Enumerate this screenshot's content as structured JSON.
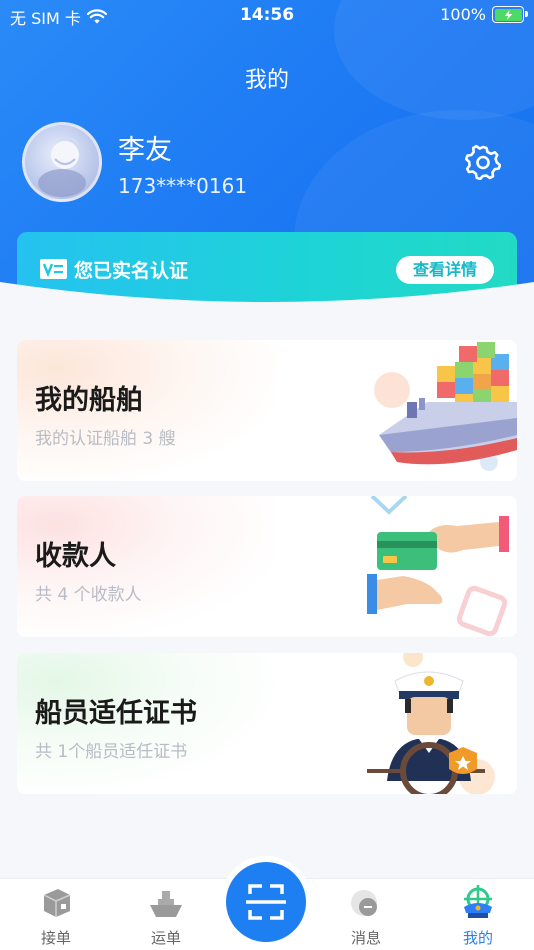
{
  "status_bar": {
    "carrier": "无 SIM 卡",
    "time": "14:56",
    "battery": "100%"
  },
  "header": {
    "title": "我的",
    "user_name": "李友",
    "phone": "173****0161"
  },
  "verify": {
    "text": "您已实名认证",
    "button": "查看详情"
  },
  "cards": [
    {
      "title": "我的船舶",
      "subtitle": "我的认证船舶 3 艘",
      "icon": "cargo-ship-icon"
    },
    {
      "title": "收款人",
      "subtitle": "共 4 个收款人",
      "icon": "payment-card-icon"
    },
    {
      "title": "船员适任证书",
      "subtitle": "共 1个船员适任证书",
      "icon": "ship-captain-icon"
    }
  ],
  "tabbar": {
    "items": [
      {
        "label": "接单",
        "icon": "box-icon"
      },
      {
        "label": "运单",
        "icon": "ship-icon"
      },
      {
        "label": "",
        "icon": "scan-icon"
      },
      {
        "label": "消息",
        "icon": "message-icon"
      },
      {
        "label": "我的",
        "icon": "captain-hat-icon",
        "active": true
      }
    ]
  },
  "colors": {
    "primary": "#1f7cf4",
    "verify_gradient_start": "#25c2f0",
    "verify_gradient_end": "#22dac4",
    "active_tab": "#2c7ff6"
  }
}
